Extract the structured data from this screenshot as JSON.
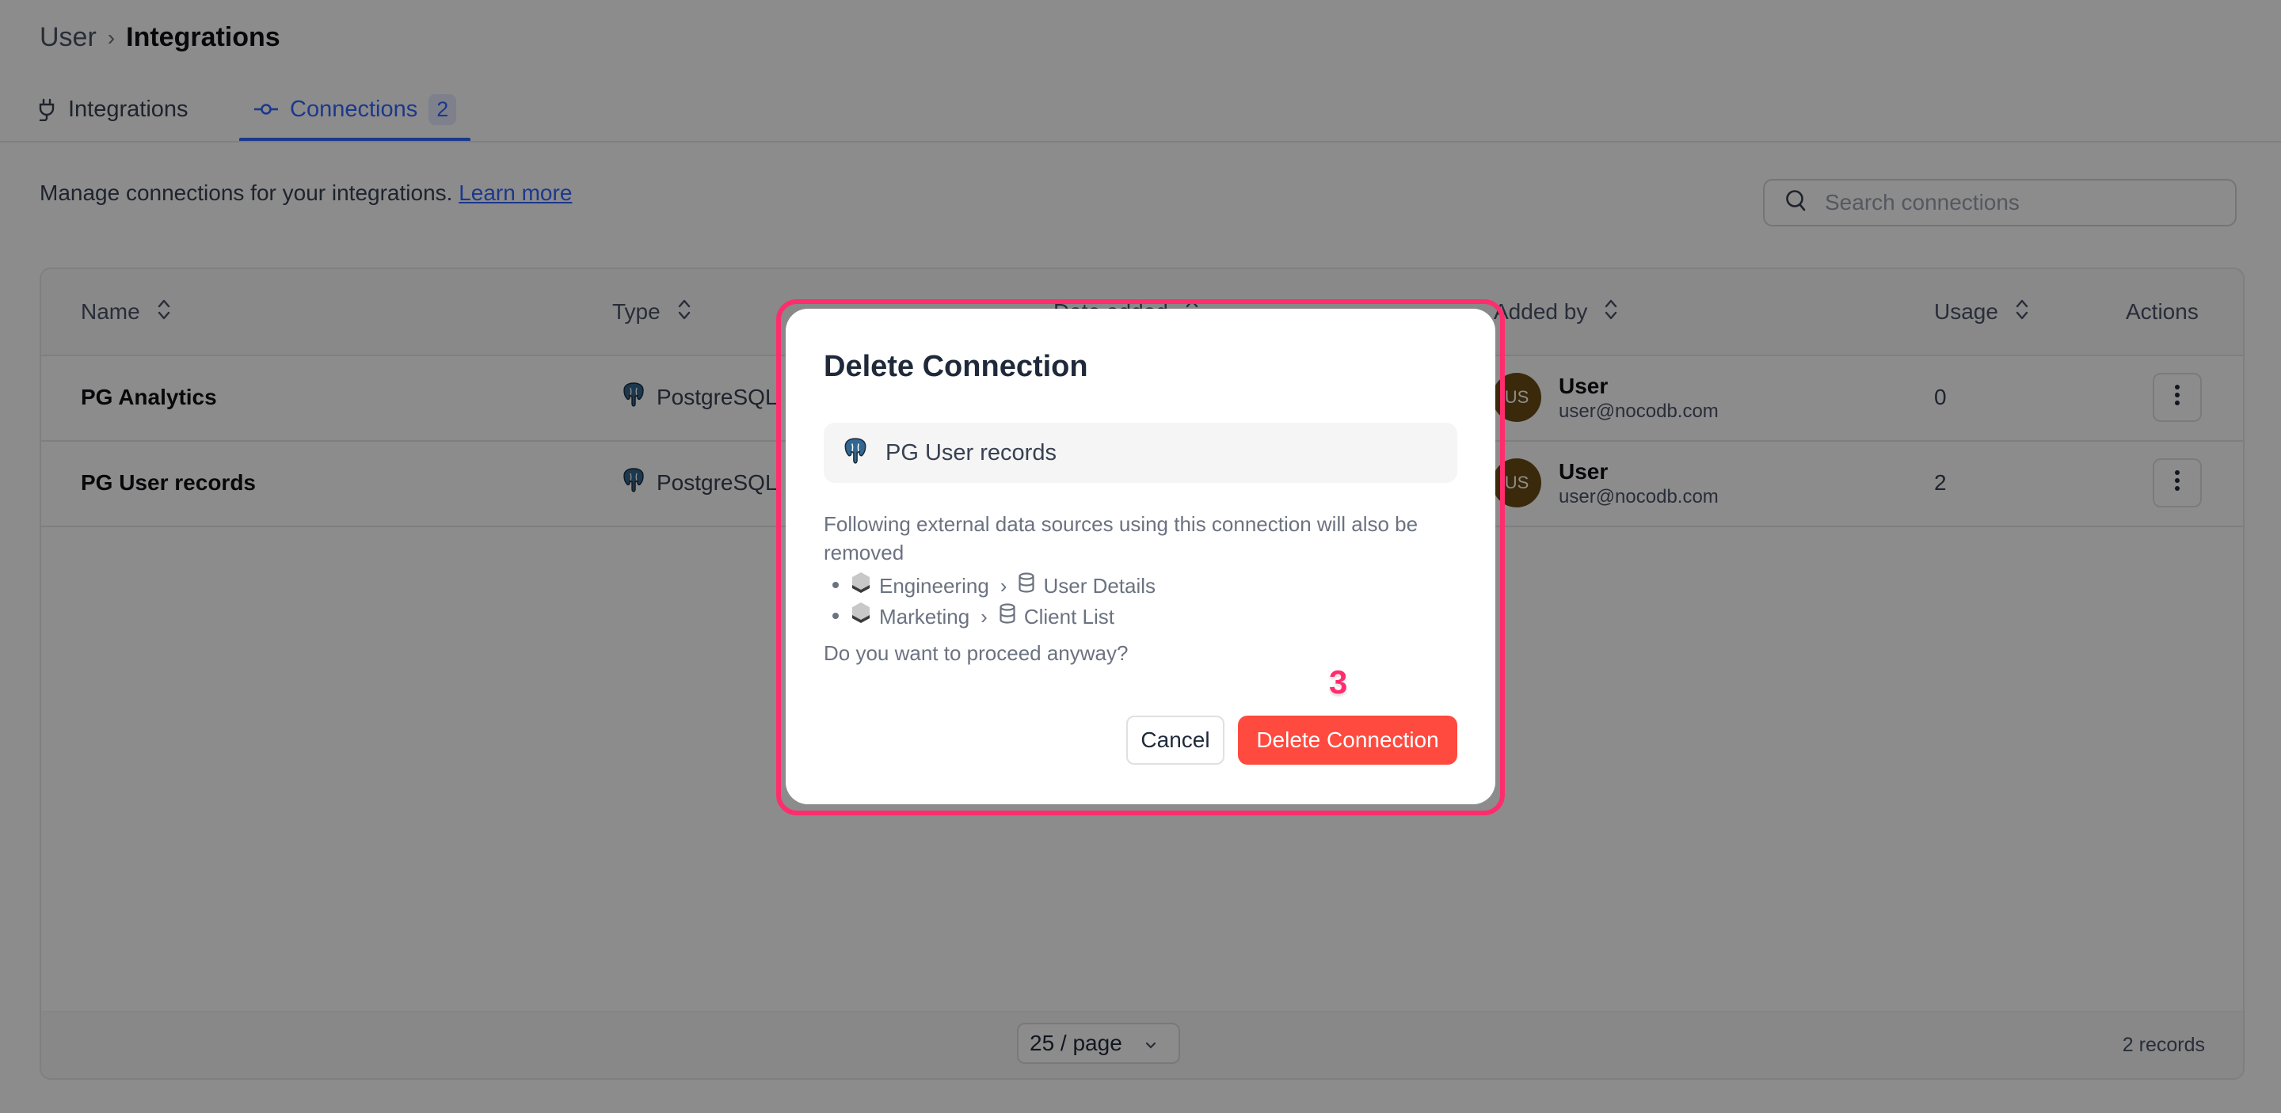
{
  "breadcrumb": {
    "root": "User",
    "separator": "›",
    "current": "Integrations"
  },
  "tabs": [
    {
      "label": "Integrations",
      "icon": "plug-icon",
      "active": false
    },
    {
      "label": "Connections",
      "icon": "connection-icon",
      "active": true,
      "badge": "2"
    }
  ],
  "description": {
    "text": "Manage connections for your integrations.",
    "link": "Learn more"
  },
  "search": {
    "placeholder": "Search connections",
    "value": ""
  },
  "table": {
    "columns": [
      "Name",
      "Type",
      "Date added",
      "Added by",
      "Usage",
      "Actions"
    ],
    "rows": [
      {
        "name": "PG Analytics",
        "type": "PostgreSQL",
        "type_icon": "postgresql-icon",
        "added_by": {
          "initials": "US",
          "name": "User",
          "email": "user@nocodb.com"
        },
        "usage": "0"
      },
      {
        "name": "PG User records",
        "type": "PostgreSQL",
        "type_icon": "postgresql-icon",
        "added_by": {
          "initials": "US",
          "name": "User",
          "email": "user@nocodb.com"
        },
        "usage": "2"
      }
    ],
    "footer": {
      "page_size": "25 / page",
      "records": "2 records"
    }
  },
  "modal": {
    "title": "Delete Connection",
    "connection_name": "PG User records",
    "message": "Following external data sources using this connection will also be removed",
    "sources": [
      {
        "base": "Engineering",
        "separator": "›",
        "source": "User Details"
      },
      {
        "base": "Marketing",
        "separator": "›",
        "source": "Client List"
      }
    ],
    "question": "Do you want to proceed anyway?",
    "cancel_label": "Cancel",
    "confirm_label": "Delete Connection",
    "step_label": "3"
  },
  "colors": {
    "accent": "#3366ff",
    "danger": "#ff4a3f",
    "highlight": "#ff2d6e",
    "avatar": "#6b4c13"
  }
}
